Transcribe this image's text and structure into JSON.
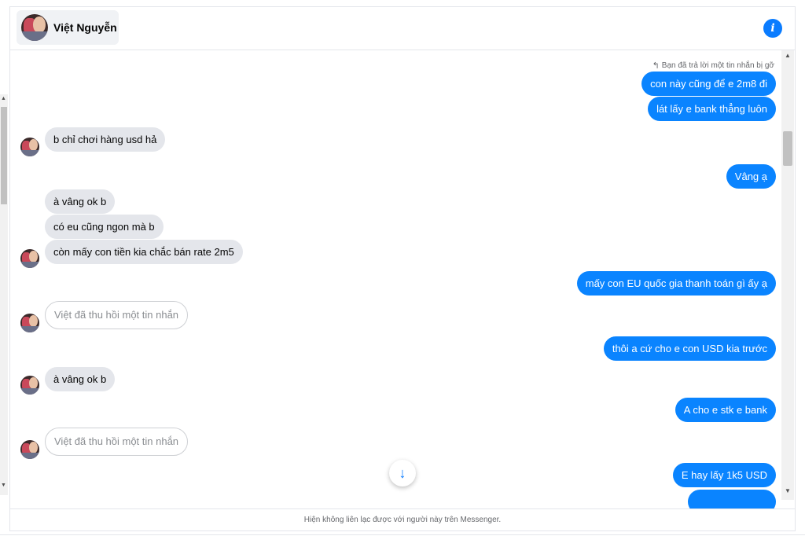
{
  "header": {
    "contact_name": "Việt Nguyễn",
    "info_icon": "info-icon"
  },
  "reply_note": "Bạn đã trả lời một tin nhắn bị gỡ",
  "messages": [
    {
      "from": "me",
      "text": "con này cũng để e 2m8 đi"
    },
    {
      "from": "me",
      "text": "lát lấy e bank thẳng luôn"
    },
    {
      "from": "them",
      "text": "b chỉ chơi hàng usd hả"
    },
    {
      "from": "me",
      "text": "Vâng ạ"
    },
    {
      "from": "them",
      "text": "à vâng ok b"
    },
    {
      "from": "them",
      "text": "có eu cũng ngon mà b"
    },
    {
      "from": "them",
      "text": "còn mấy con tiền kia chắc bán rate 2m5"
    },
    {
      "from": "me",
      "text": "mấy con EU quốc gia thanh toán gì ấy ạ"
    },
    {
      "from": "them",
      "text": "Việt đã thu hồi một tin nhắn",
      "recalled": true
    },
    {
      "from": "me",
      "text": "thôi a cứ cho e con USD kia trước"
    },
    {
      "from": "them",
      "text": "à vâng ok b"
    },
    {
      "from": "me",
      "text": "A cho e stk e bank"
    },
    {
      "from": "them",
      "text": "Việt đã thu hồi một tin nhắn",
      "recalled": true
    },
    {
      "from": "me",
      "text": "E hay lấy 1k5 USD"
    }
  ],
  "scroll_down_icon": "arrow-down-icon",
  "footer_text": "Hiện không liên lạc được với người này trên Messenger.",
  "colors": {
    "outgoing_bubble": "#0a84ff",
    "incoming_bubble": "#e4e6eb",
    "accent": "#0a7cff"
  }
}
